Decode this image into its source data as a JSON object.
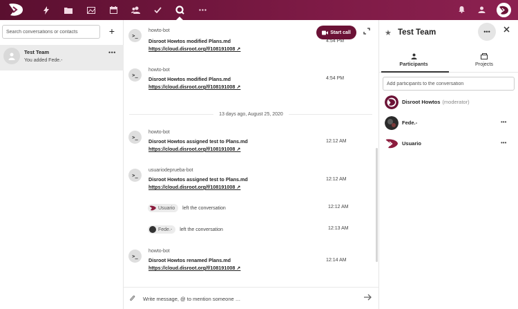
{
  "nav": {
    "icons": [
      "logo",
      "activity-icon",
      "files-icon",
      "gallery-icon",
      "calendar-icon",
      "contacts-icon",
      "tasks-icon",
      "talk-icon",
      "more-apps-icon"
    ],
    "active": "talk-icon",
    "right_icons": [
      "notifications-icon",
      "contacts-menu-icon",
      "user-avatar"
    ]
  },
  "left": {
    "search_placeholder": "Search conversations or contacts",
    "conversation": {
      "title": "Test Team",
      "subtitle": "You added Fede.-"
    }
  },
  "chat": {
    "start_call_label": "Start call",
    "messages": [
      {
        "author": "howto-bot",
        "text": "Disroot Howtos modified Plans.md ",
        "link": "https://cloud.disroot.org/f/108191008 ↗",
        "time": "4:54 PM"
      },
      {
        "author": "howto-bot",
        "text": "Disroot Howtos modified Plans.md ",
        "link": "https://cloud.disroot.org/f/108191008 ↗",
        "time": "4:54 PM"
      },
      {
        "author": "howto-bot",
        "text": "Disroot Howtos assigned test to Plans.md ",
        "link": "https://cloud.disroot.org/f/108191008 ↗",
        "time": "12:12 AM"
      },
      {
        "author": "usuariodeprueba-bot",
        "text": "Disroot Howtos assigned test to Plans.md ",
        "link": "https://cloud.disroot.org/f/108191008 ↗",
        "time": "12:12 AM"
      },
      {
        "author": "howto-bot",
        "text": "Disroot Howtos renamed Plans.md ",
        "link": "https://cloud.disroot.org/f/108191008 ↗",
        "time": "12:14 AM"
      }
    ],
    "date_divider": "13 days ago, August 25, 2020",
    "system": [
      {
        "who": "Usuario",
        "text": "left the conversation",
        "time": "12:12 AM"
      },
      {
        "who": "Fede.-",
        "text": "left the conversation",
        "time": "12:13 AM"
      }
    ],
    "composer_placeholder": "Write message, @ to mention someone …"
  },
  "right": {
    "title": "Test Team",
    "tabs": [
      "Participants",
      "Projects"
    ],
    "active_tab": "Participants",
    "add_placeholder": "Add participants to the conversation",
    "participants": [
      {
        "name": "Disroot Howtos",
        "role": "(moderator)"
      },
      {
        "name": "Fede.-",
        "role": ""
      },
      {
        "name": "Usuario",
        "role": ""
      }
    ]
  },
  "colors": {
    "brand": "#6b1236",
    "topbar_start": "#5a0f2f",
    "topbar_end": "#8c2150"
  }
}
